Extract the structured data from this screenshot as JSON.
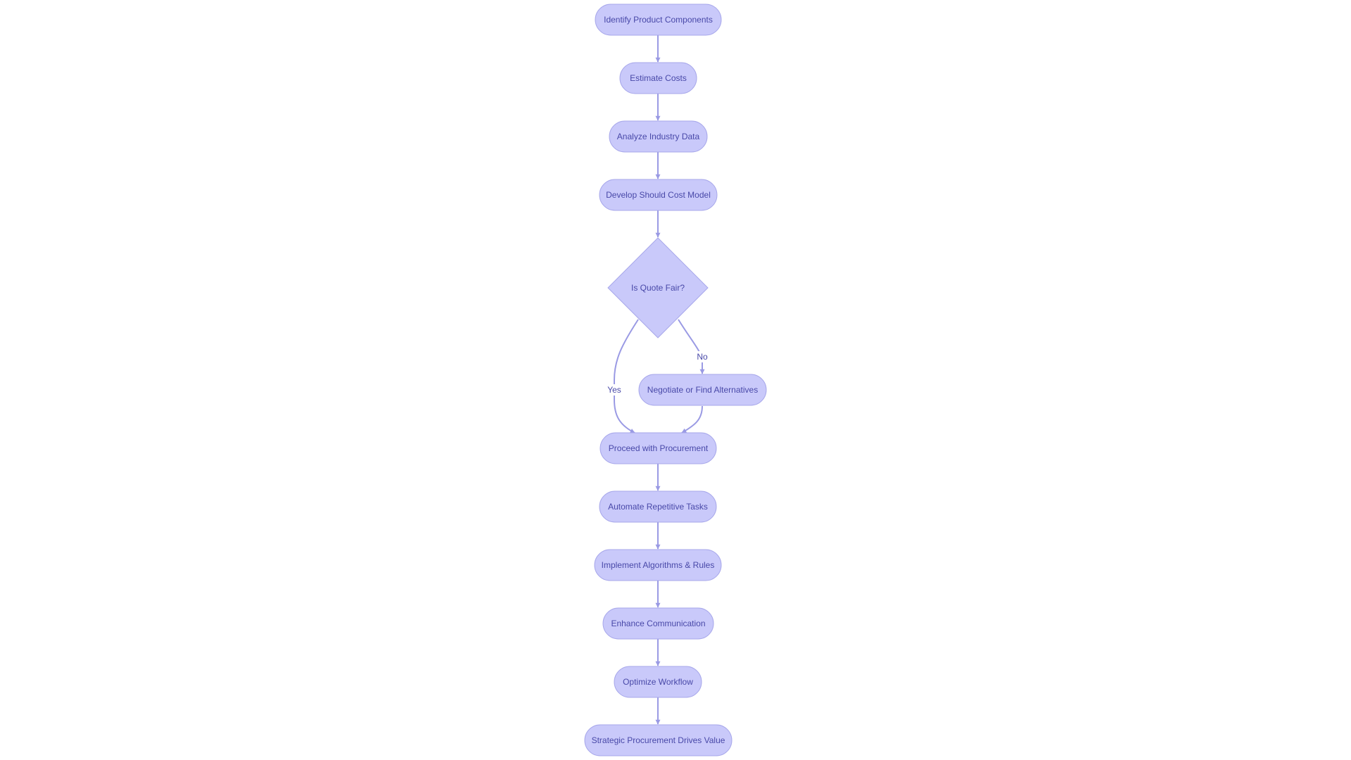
{
  "diagram": {
    "type": "flowchart",
    "direction": "top-to-bottom",
    "colors": {
      "node_fill": "#c9c9fa",
      "node_stroke": "#a7a7ea",
      "edge": "#9a9ae4",
      "text": "#4848a8"
    },
    "nodes": [
      {
        "id": "identify",
        "label": "Identify Product Components",
        "shape": "stadium"
      },
      {
        "id": "estimate",
        "label": "Estimate Costs",
        "shape": "stadium"
      },
      {
        "id": "analyze",
        "label": "Analyze Industry Data",
        "shape": "stadium"
      },
      {
        "id": "develop",
        "label": "Develop Should Cost Model",
        "shape": "stadium"
      },
      {
        "id": "fair",
        "label": "Is Quote Fair?",
        "shape": "diamond"
      },
      {
        "id": "negotiate",
        "label": "Negotiate or Find Alternatives",
        "shape": "stadium"
      },
      {
        "id": "proceed",
        "label": "Proceed with Procurement",
        "shape": "stadium"
      },
      {
        "id": "automate",
        "label": "Automate Repetitive Tasks",
        "shape": "stadium"
      },
      {
        "id": "implement",
        "label": "Implement Algorithms & Rules",
        "shape": "stadium"
      },
      {
        "id": "enhance",
        "label": "Enhance Communication",
        "shape": "stadium"
      },
      {
        "id": "optimize",
        "label": "Optimize Workflow",
        "shape": "stadium"
      },
      {
        "id": "strategic",
        "label": "Strategic Procurement Drives Value",
        "shape": "stadium"
      }
    ],
    "edges": [
      {
        "from": "identify",
        "to": "estimate",
        "label": ""
      },
      {
        "from": "estimate",
        "to": "analyze",
        "label": ""
      },
      {
        "from": "analyze",
        "to": "develop",
        "label": ""
      },
      {
        "from": "develop",
        "to": "fair",
        "label": ""
      },
      {
        "from": "fair",
        "to": "proceed",
        "label": "Yes"
      },
      {
        "from": "fair",
        "to": "negotiate",
        "label": "No"
      },
      {
        "from": "negotiate",
        "to": "proceed",
        "label": ""
      },
      {
        "from": "proceed",
        "to": "automate",
        "label": ""
      },
      {
        "from": "automate",
        "to": "implement",
        "label": ""
      },
      {
        "from": "implement",
        "to": "enhance",
        "label": ""
      },
      {
        "from": "enhance",
        "to": "optimize",
        "label": ""
      },
      {
        "from": "optimize",
        "to": "strategic",
        "label": ""
      }
    ]
  }
}
